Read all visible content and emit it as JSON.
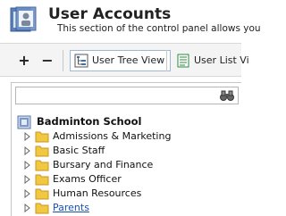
{
  "header": {
    "title": "User Accounts",
    "description": "This section of the control panel allows you"
  },
  "toolbar": {
    "add_label": "+",
    "remove_label": "−",
    "tree_view_label": "User Tree View",
    "list_view_label": "User List Vi"
  },
  "search": {
    "value": "",
    "placeholder": ""
  },
  "tree": {
    "root_label": "Badminton School",
    "items": [
      {
        "label": "Admissions & Marketing"
      },
      {
        "label": "Basic Staff"
      },
      {
        "label": "Bursary and Finance"
      },
      {
        "label": "Exams Officer"
      },
      {
        "label": "Human Resources"
      },
      {
        "label": "Parents"
      }
    ]
  },
  "colors": {
    "folder": "#f2c744",
    "link": "#1a4fb0",
    "toolbar_bg": "#f4f4f4"
  }
}
